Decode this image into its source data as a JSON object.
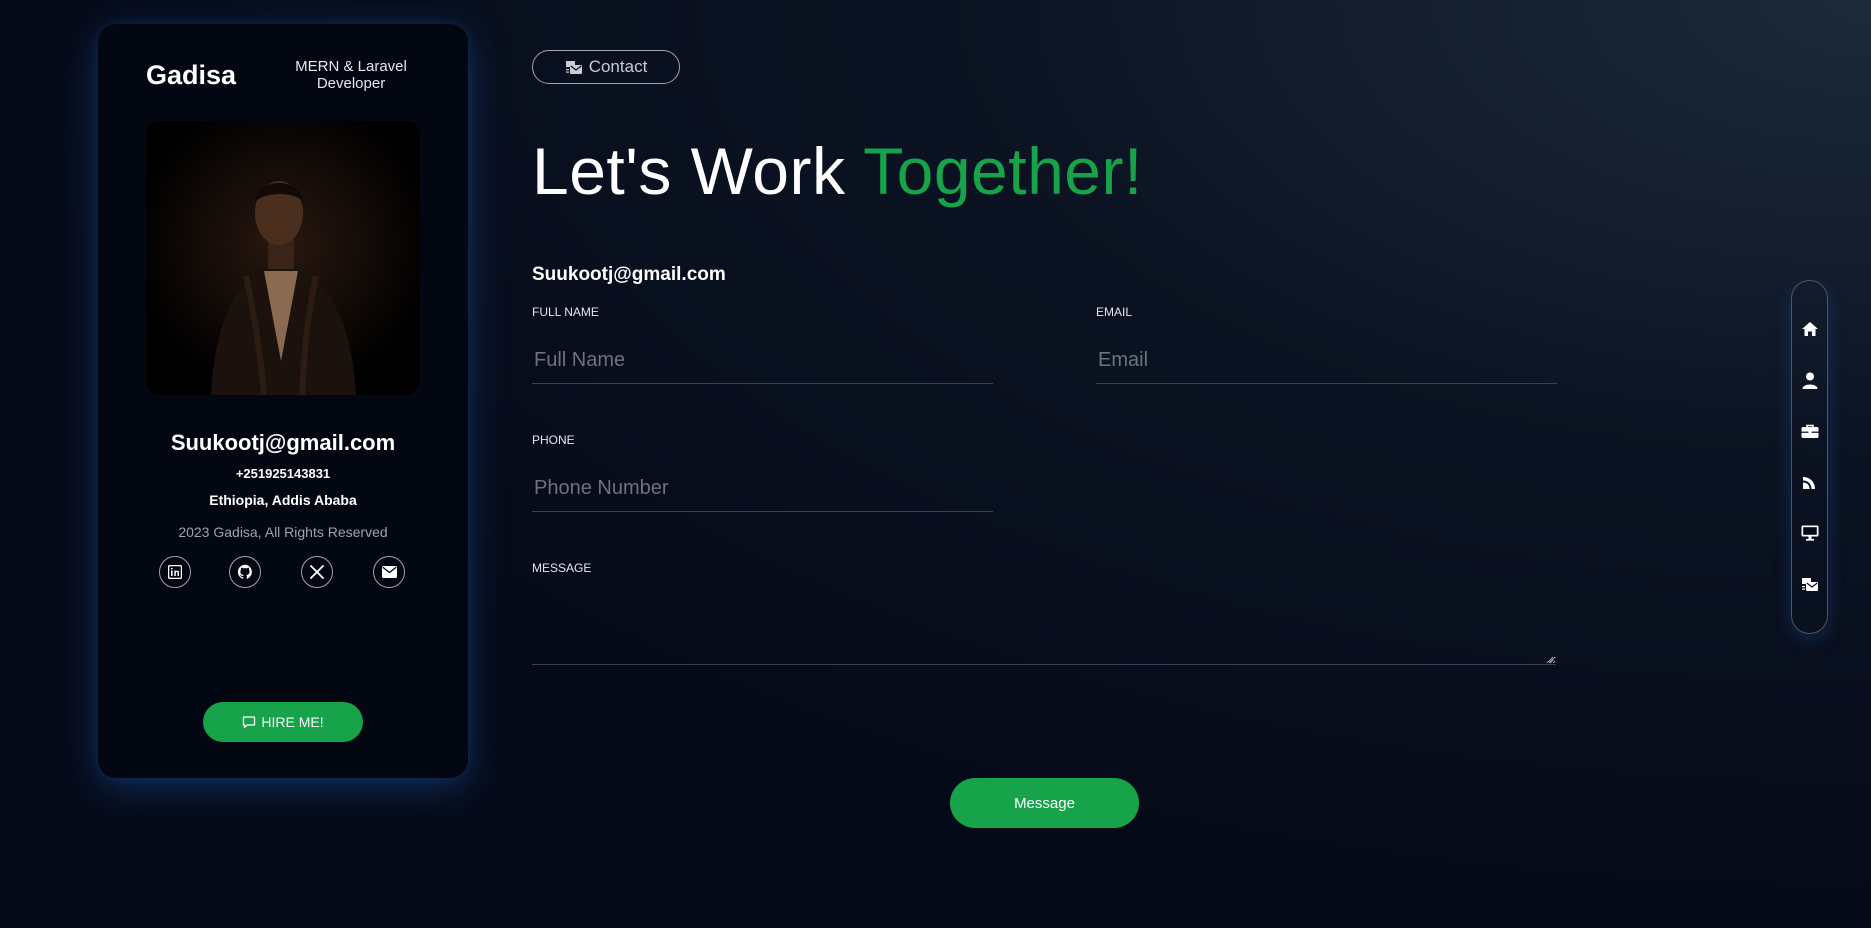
{
  "profile": {
    "name": "Gadisa",
    "role": "MERN & Laravel Developer",
    "email": "Suukootj@gmail.com",
    "phone": "+251925143831",
    "location": "Ethiopia, Addis Ababa",
    "copyright": "2023 Gadisa, All Rights Reserved",
    "socials": [
      "linkedin-icon",
      "github-icon",
      "x-icon",
      "envelope-icon"
    ],
    "hire_label": "HIRE ME!"
  },
  "section": {
    "pill_label": "Contact",
    "headline_white": "Let's Work",
    "headline_green": "Together!",
    "email": "Suukootj@gmail.com"
  },
  "form": {
    "full_name_label": "FULL NAME",
    "full_name_placeholder": "Full Name",
    "email_label": "EMAIL",
    "email_placeholder": "Email",
    "phone_label": "PHONE",
    "phone_placeholder": "Phone Number",
    "message_label": "MESSAGE",
    "submit_label": "Message"
  },
  "sidenav": [
    "home-icon",
    "user-icon",
    "briefcase-icon",
    "feed-icon",
    "desktop-icon",
    "contact-card-icon"
  ],
  "colors": {
    "accent": "#16a34a",
    "background": "#050a18",
    "card": "#030712"
  }
}
